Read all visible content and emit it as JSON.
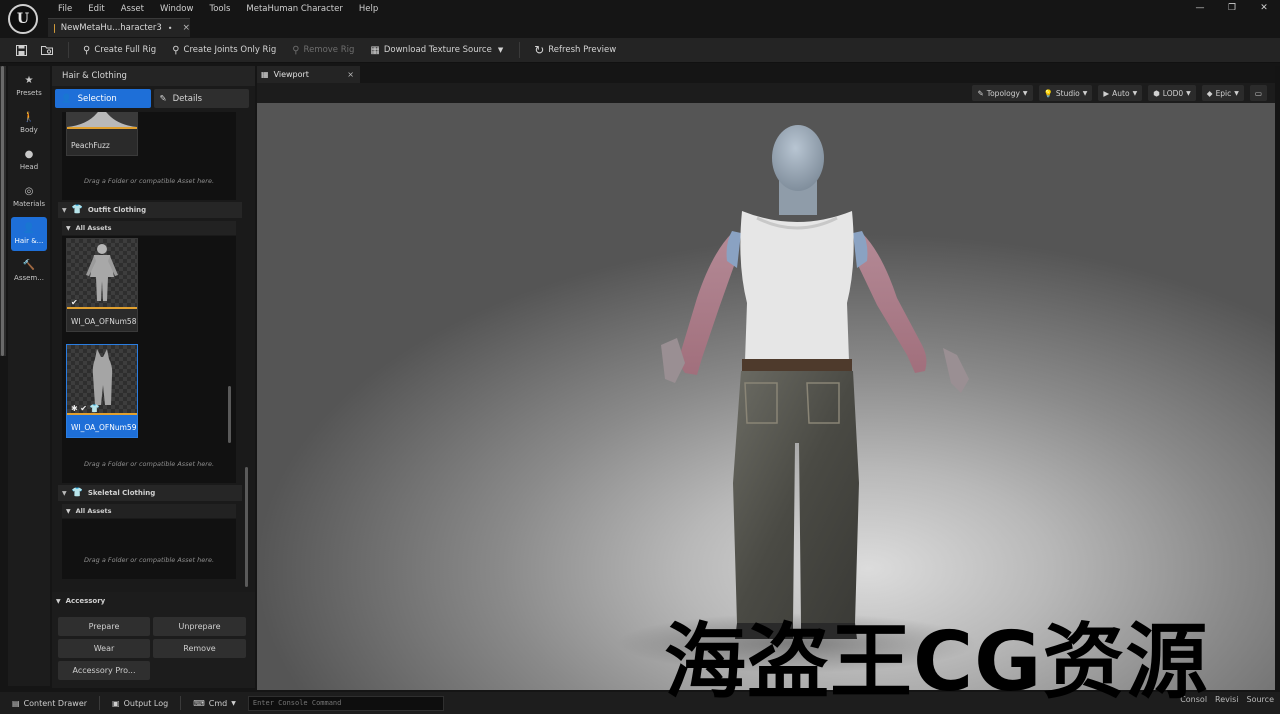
{
  "app": {
    "logo_letter": "U",
    "menu": [
      "File",
      "Edit",
      "Asset",
      "Window",
      "Tools",
      "MetaHuman Character",
      "Help"
    ],
    "document_tab": {
      "title": "NewMetaHu...haracter3",
      "modified_marker": "•",
      "close": "×"
    },
    "window_controls": [
      "—",
      "❐",
      "✕"
    ]
  },
  "toolbar": {
    "create_full_rig": "Create Full Rig",
    "create_joints_only_rig": "Create Joints Only Rig",
    "remove_rig": "Remove Rig",
    "download_texture_source": "Download Texture Source",
    "refresh_preview": "Refresh Preview"
  },
  "mode_rail": {
    "items": [
      {
        "label": "Presets",
        "icon": "★",
        "active": false
      },
      {
        "label": "Body",
        "icon": "🚶",
        "active": false
      },
      {
        "label": "Head",
        "icon": "●",
        "active": false
      },
      {
        "label": "Materials",
        "icon": "◎",
        "active": false
      },
      {
        "label": "Hair &...",
        "icon": "👤",
        "active": true
      },
      {
        "label": "Assem...",
        "icon": "🔨",
        "active": false
      }
    ]
  },
  "panel": {
    "title": "Hair & Clothing",
    "tabs": {
      "selection": "Selection",
      "details": "Details"
    },
    "peachfuzz": {
      "label": "PeachFuzz"
    },
    "drop_hint": "Drag a Folder or compatible Asset here.",
    "outfit_section": "Outfit Clothing",
    "all_assets": "All Assets",
    "outfit_assets": [
      {
        "label": "WI_OA_OFNum58",
        "selected": false,
        "badges": "✔"
      },
      {
        "label": "WI_OA_OFNum59",
        "selected": true,
        "badges": "✱ ✔ 👕"
      }
    ],
    "skeletal_section": "Skeletal Clothing",
    "accessory": {
      "title": "Accessory",
      "prepare": "Prepare",
      "unprepare": "Unprepare",
      "wear": "Wear",
      "remove": "Remove",
      "properties": "Accessory Pro..."
    }
  },
  "viewport": {
    "tab_title": "Viewport",
    "options": [
      {
        "label": "Topology",
        "icon": "✎"
      },
      {
        "label": "Studio",
        "icon": "💡"
      },
      {
        "label": "Auto",
        "icon": "▶"
      },
      {
        "label": "LOD0",
        "icon": "⬢"
      },
      {
        "label": "Epic",
        "icon": "◆"
      }
    ]
  },
  "statusbar": {
    "content_drawer": "Content Drawer",
    "output_log": "Output Log",
    "cmd": "Cmd",
    "console_placeholder": "Enter Console Command",
    "right_items": [
      "Consol",
      "Revisi",
      "Source"
    ]
  },
  "watermark": "海盗王CG资源",
  "colors": {
    "accent_blue": "#1e6fd8",
    "tile_underline": "#e0a030",
    "background": "#151515"
  }
}
